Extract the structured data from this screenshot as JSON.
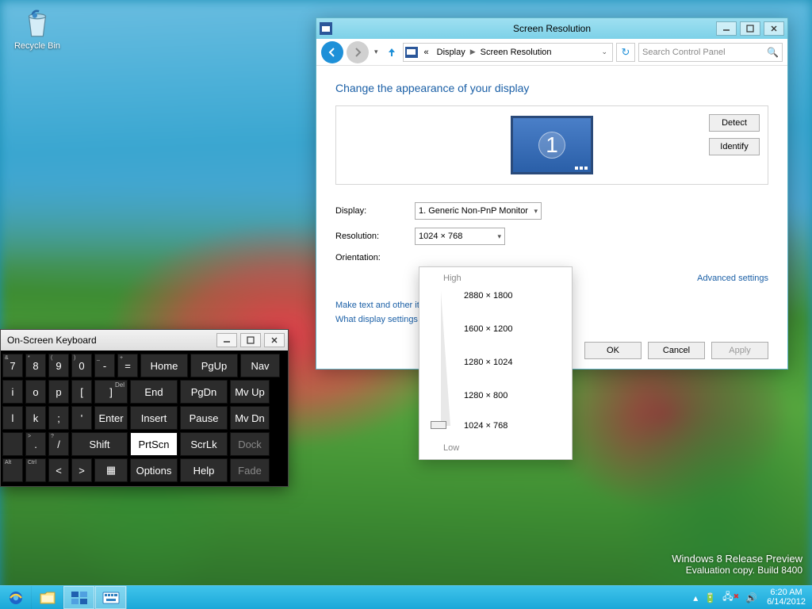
{
  "desktop": {
    "recycle_label": "Recycle Bin",
    "watermark_line1": "Windows 8 Release Preview",
    "watermark_line2": "Evaluation copy. Build 8400"
  },
  "taskbar": {
    "clock_time": "6:20 AM",
    "clock_date": "6/14/2012"
  },
  "window": {
    "title": "Screen Resolution",
    "breadcrumb": {
      "item1": "Display",
      "item2": "Screen Resolution",
      "prefix": "«"
    },
    "search_placeholder": "Search Control Panel",
    "heading": "Change the appearance of your display",
    "monitor_number": "1",
    "buttons": {
      "detect": "Detect",
      "identify": "Identify",
      "ok": "OK",
      "cancel": "Cancel",
      "apply": "Apply"
    },
    "labels": {
      "display": "Display:",
      "resolution": "Resolution:",
      "orientation": "Orientation:"
    },
    "display_value": "1. Generic Non-PnP Monitor",
    "resolution_value": "1024 × 768",
    "links": {
      "advanced": "Advanced settings",
      "text_size": "Make text and other items larger or smaller",
      "what_settings": "What display settings should I choose?"
    }
  },
  "res_dropdown": {
    "high": "High",
    "low": "Low",
    "options": [
      "2880 × 1800",
      "1600 × 1200",
      "1280 × 1024",
      "1280 × 800",
      "1024 × 768"
    ]
  },
  "osk": {
    "title": "On-Screen Keyboard",
    "row1": [
      "7",
      "8",
      "9",
      "0",
      "-",
      "=",
      "Home",
      "PgUp",
      "Nav"
    ],
    "row1sub": [
      "&",
      "*",
      "(",
      ")",
      "_",
      "+",
      "",
      "",
      ""
    ],
    "row2": [
      "i",
      "o",
      "p",
      "[",
      "]",
      "End",
      "PgDn",
      "Mv Up"
    ],
    "row2del": "Del",
    "row3": [
      "l",
      "k",
      ";",
      "'",
      "Enter",
      "Insert",
      "Pause",
      "Mv Dn"
    ],
    "row4": [
      ".",
      "/",
      "Shift",
      "PrtScn",
      "ScrLk",
      "Dock"
    ],
    "row4sub": [
      ">",
      "?",
      "",
      "",
      "",
      ""
    ],
    "row5_alt": "Alt",
    "row5_ctrl": "Ctrl",
    "row5": [
      "<",
      ">",
      "Options",
      "Help",
      "Fade"
    ]
  }
}
